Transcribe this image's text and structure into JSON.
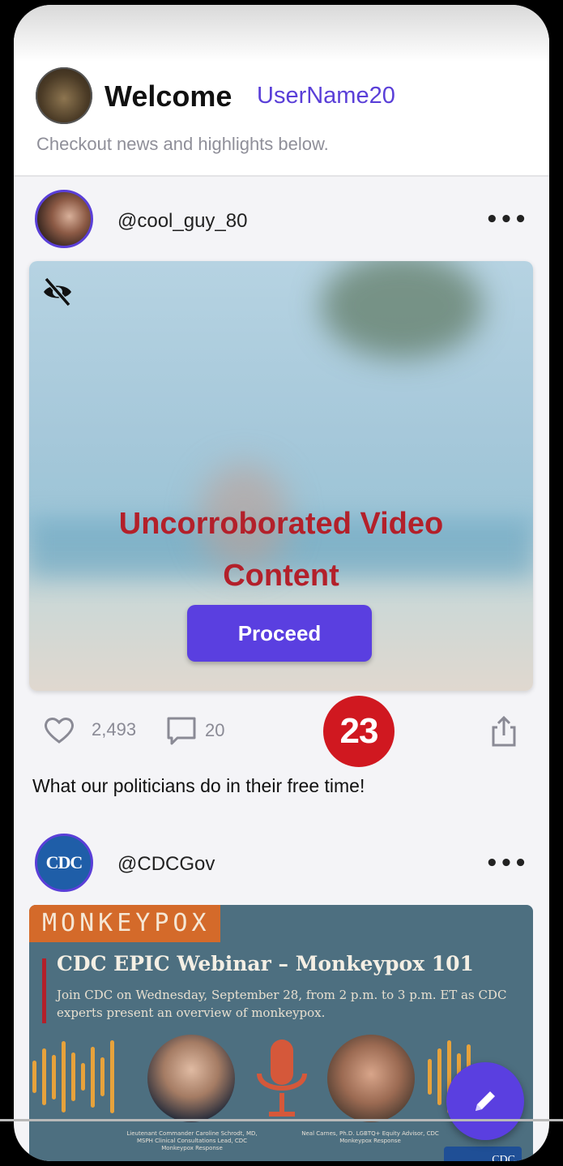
{
  "header": {
    "welcome": "Welcome",
    "username": "UserName20",
    "subtitle": "Checkout news and highlights below."
  },
  "posts": [
    {
      "handle": "@cool_guy_80",
      "more_label": "•••",
      "warning_line1": "Uncorroborated Video",
      "warning_line2": "Content",
      "proceed_label": "Proceed",
      "likes": "2,493",
      "comments": "20",
      "badge": "23",
      "caption": "What our politicians do in their free time!"
    },
    {
      "handle": "@CDCGov",
      "avatar_text": "CDC",
      "more_label": "•••",
      "tag": "MONKEYPOX",
      "title": "CDC EPIC Webinar – Monkeypox 101",
      "description": "Join CDC on Wednesday, September 28, from 2 p.m. to 3 p.m. ET as CDC experts present an overview of monkeypox.",
      "speaker1": "Lieutenant Commander Caroline Schrodt, MD, MSPH Clinical Consultations Lead, CDC Monkeypox Response",
      "speaker2": "Neal Carnes, Ph.D. LGBTQ+ Equity Advisor, CDC Monkeypox Response",
      "logo_text": "CDC"
    }
  ],
  "colors": {
    "accent": "#5a3fe0",
    "warning": "#b3202a",
    "badge": "#d01820"
  },
  "icons": [
    "hidden-eye-icon",
    "heart-icon",
    "comment-icon",
    "share-icon",
    "more-icon",
    "pencil-icon",
    "microphone-icon"
  ]
}
